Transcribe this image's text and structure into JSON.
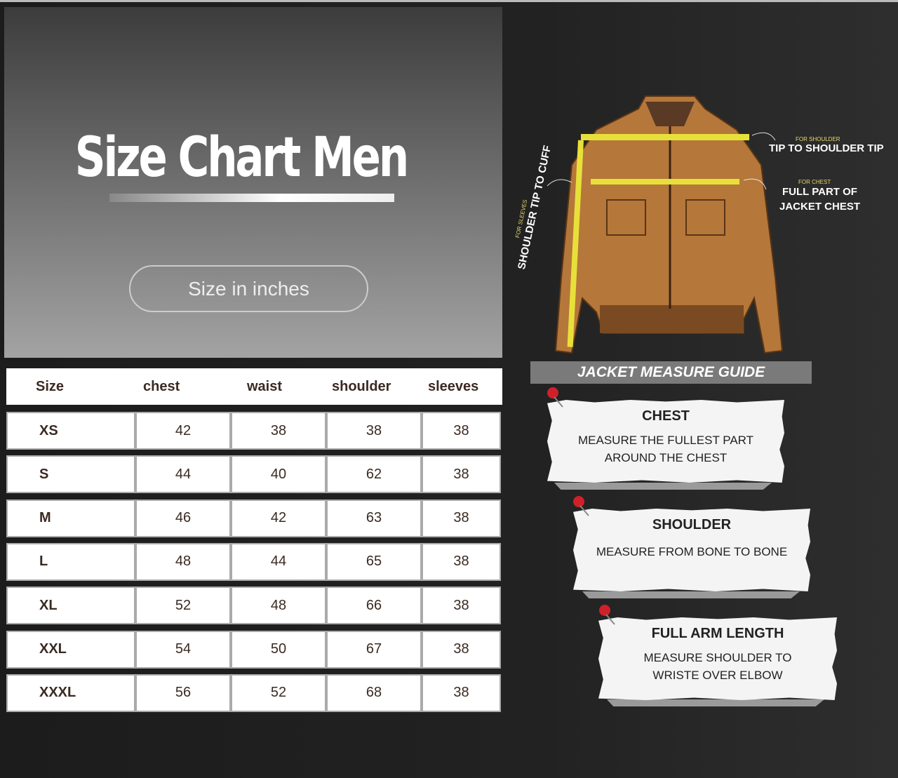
{
  "hero": {
    "title": "Size Chart Men",
    "unit_pill": "Size in inches"
  },
  "table": {
    "headers": [
      "Size",
      "chest",
      "waist",
      "shoulder",
      "sleeves"
    ],
    "rows": [
      [
        "XS",
        "42",
        "38",
        "38",
        "38"
      ],
      [
        "S",
        "44",
        "40",
        "62",
        "38"
      ],
      [
        "M",
        "46",
        "42",
        "63",
        "38"
      ],
      [
        "L",
        "48",
        "44",
        "65",
        "38"
      ],
      [
        "XL",
        "52",
        "48",
        "66",
        "38"
      ],
      [
        "XXL",
        "54",
        "50",
        "67",
        "38"
      ],
      [
        "XXXL",
        "56",
        "52",
        "68",
        "38"
      ]
    ]
  },
  "jacket": {
    "shoulder_small": "FOR SHOULDER",
    "shoulder_label": "TIP TO SHOULDER TIP",
    "chest_small": "FOR CHEST",
    "chest_label_1": "FULL PART OF",
    "chest_label_2": "JACKET CHEST",
    "sleeves_small": "FOR SLEEVES",
    "sleeves_label": "SHOULDER TIP TO CUFF"
  },
  "guide": {
    "title": "JACKET MEASURE GUIDE",
    "notes": [
      {
        "title": "CHEST",
        "line1": "MEASURE THE FULLEST PART",
        "line2": "AROUND THE CHEST"
      },
      {
        "title": "SHOULDER",
        "line1": "MEASURE FROM BONE TO BONE",
        "line2": ""
      },
      {
        "title": "FULL ARM LENGTH",
        "line1": "MEASURE SHOULDER TO",
        "line2": "WRISTE OVER ELBOW"
      }
    ]
  },
  "colors": {
    "jacket": "#b5773a",
    "tape": "#e8e03a",
    "pin": "#d0202a"
  }
}
